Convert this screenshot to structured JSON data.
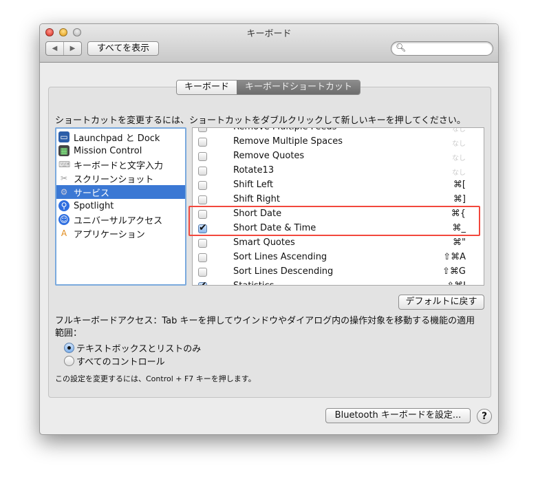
{
  "window": {
    "title": "キーボード"
  },
  "toolbar": {
    "show_all": "すべてを表示",
    "back_icon": "◀",
    "forward_icon": "▶",
    "search_placeholder": ""
  },
  "tabs": [
    {
      "label": "キーボード",
      "selected": false
    },
    {
      "label": "キーボードショートカット",
      "selected": true
    }
  ],
  "instruction": "ショートカットを変更するには、ショートカットをダブルクリックして新しいキーを押してください。",
  "categories": [
    {
      "label": "Launchpad と Dock",
      "icon": "launchpad-icon"
    },
    {
      "label": "Mission Control",
      "icon": "mission-control-icon"
    },
    {
      "label": "キーボードと文字入力",
      "icon": "keyboard-icon"
    },
    {
      "label": "スクリーンショット",
      "icon": "screenshot-icon"
    },
    {
      "label": "サービス",
      "icon": "gear-icon",
      "selected": true
    },
    {
      "label": "Spotlight",
      "icon": "spotlight-icon"
    },
    {
      "label": "ユニバーサルアクセス",
      "icon": "accessibility-icon"
    },
    {
      "label": "アプリケーション",
      "icon": "applications-icon"
    }
  ],
  "shortcuts": [
    {
      "label": "Remove Multiple Feeds",
      "checked": false,
      "shortcut": "なし"
    },
    {
      "label": "Remove Multiple Spaces",
      "checked": false,
      "shortcut": "なし"
    },
    {
      "label": "Remove Quotes",
      "checked": false,
      "shortcut": "なし"
    },
    {
      "label": "Rotate13",
      "checked": false,
      "shortcut": "なし"
    },
    {
      "label": "Shift Left",
      "checked": false,
      "shortcut": "⌘["
    },
    {
      "label": "Shift Right",
      "checked": false,
      "shortcut": "⌘]"
    },
    {
      "label": "Short Date",
      "checked": false,
      "shortcut": "⌘{"
    },
    {
      "label": "Short Date & Time",
      "checked": true,
      "shortcut": "⌘_"
    },
    {
      "label": "Smart Quotes",
      "checked": false,
      "shortcut": "⌘\""
    },
    {
      "label": "Sort Lines Ascending",
      "checked": false,
      "shortcut": "⇧⌘A"
    },
    {
      "label": "Sort Lines Descending",
      "checked": false,
      "shortcut": "⇧⌘G"
    },
    {
      "label": "Statistics",
      "checked": true,
      "shortcut": "⇧⌘I"
    }
  ],
  "highlight_color": "#f2473c",
  "restore_defaults": "デフォルトに戻す",
  "full_keyboard_access": {
    "line1": "フルキーボードアクセス：Tab キーを押してウインドウやダイアログ内の操作対象を移動する機能の適用",
    "line2": "範囲：",
    "options": [
      {
        "label": "テキストボックスとリストのみ",
        "selected": true
      },
      {
        "label": "すべてのコントロール",
        "selected": false
      }
    ],
    "note": "この設定を変更するには、Control + F7 キーを押します。"
  },
  "bluetooth_button": "Bluetooth キーボードを設定...",
  "help": "?"
}
